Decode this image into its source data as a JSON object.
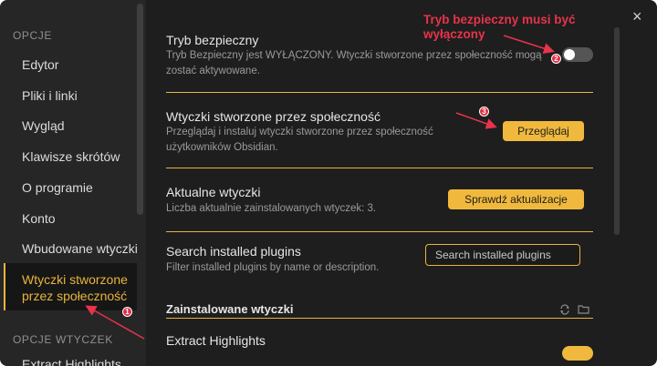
{
  "sidebar": {
    "heading_options": "OPCJE",
    "items": [
      {
        "label": "Edytor"
      },
      {
        "label": "Pliki i linki"
      },
      {
        "label": "Wygląd"
      },
      {
        "label": "Klawisze skrótów"
      },
      {
        "label": "O programie"
      },
      {
        "label": "Konto"
      },
      {
        "label": "Wbudowane wtyczki"
      }
    ],
    "active_item": {
      "line1": "Wtyczki stworzone",
      "line2": "przez społeczność"
    },
    "heading_plugin_options": "OPCJE WTYCZEK",
    "partial_item": "Extract Highlights"
  },
  "main": {
    "close_icon": "×",
    "safe_mode": {
      "title": "Tryb bezpieczny",
      "desc": "Tryb Bezpieczny jest WYŁĄCZONY. Wtyczki stworzone przez społeczność mogą zostać aktywowane.",
      "toggle_on": false
    },
    "community_plugins": {
      "title": "Wtyczki stworzone przez społeczność",
      "desc": "Przeglądaj i instaluj wtyczki stworzone przez społeczność użytkowników Obsidian.",
      "button": "Przeglądaj"
    },
    "current_plugins": {
      "title": "Aktualne wtyczki",
      "desc": "Liczba aktualnie zainstalowanych wtyczek: 3.",
      "button": "Sprawdź aktualizacje"
    },
    "search_plugins": {
      "title": "Search installed plugins",
      "desc": "Filter installed plugins by name or description.",
      "placeholder": "Search installed plugins"
    },
    "installed_section": {
      "title": "Zainstalowane wtyczki",
      "reload_icon": "reload-icon",
      "folder_icon": "folder-icon"
    },
    "plugin_row": {
      "title": "Extract Highlights"
    }
  },
  "annotations": {
    "note": "Tryb bezpieczny musi być\nwyłączony",
    "badges": [
      "1",
      "2",
      "3"
    ]
  },
  "colors": {
    "accent": "#e8b43c",
    "annotation": "#e8334a",
    "background": "#1e1e1e"
  }
}
